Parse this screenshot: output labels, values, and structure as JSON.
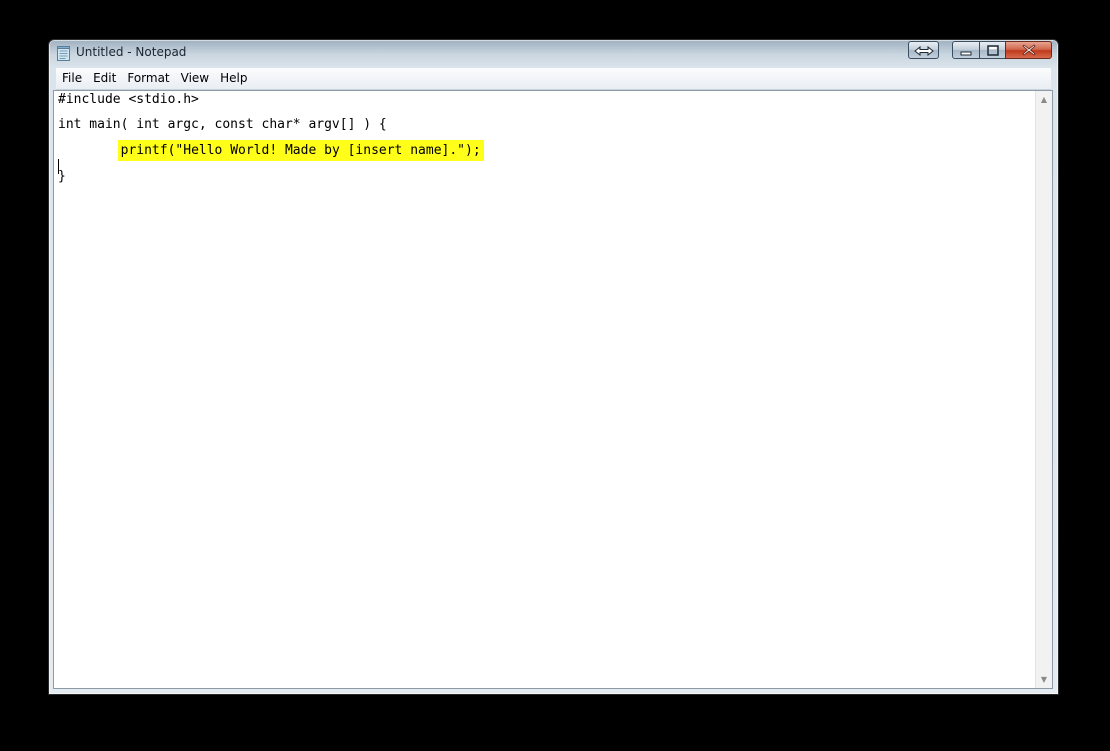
{
  "window": {
    "title": "Untitled - Notepad",
    "icon": "notepad-icon"
  },
  "controls": {
    "resize_icon": "resize-arrows-icon",
    "minimize_icon": "minimize-icon",
    "maximize_icon": "maximize-icon",
    "close_icon": "close-icon"
  },
  "menu": {
    "items": [
      {
        "label": "File"
      },
      {
        "label": "Edit"
      },
      {
        "label": "Format"
      },
      {
        "label": "View"
      },
      {
        "label": "Help"
      }
    ]
  },
  "editor": {
    "lines": [
      {
        "text": "#include <stdio.h>"
      },
      {
        "text": "int main( int argc, const char* argv[] ) {"
      },
      {
        "text": "        "
      },
      {
        "text": "printf(\"Hello World! Made by [insert name].\");"
      },
      {
        "text": "}"
      }
    ],
    "highlight_color": "#ffff1a"
  },
  "scrollbar": {
    "up_icon": "scroll-up-arrow-icon",
    "down_icon": "scroll-down-arrow-icon"
  }
}
